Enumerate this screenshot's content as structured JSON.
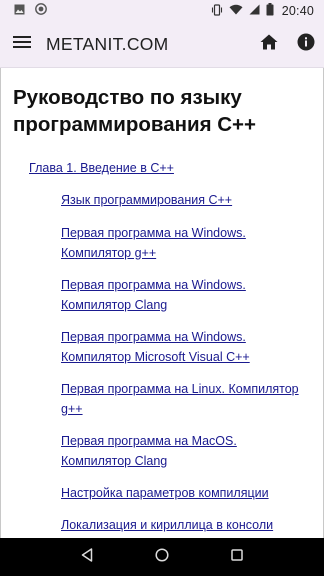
{
  "status_bar": {
    "time": "20:40",
    "icons": [
      "image-icon",
      "record-icon",
      "vibrate-icon",
      "wifi-icon",
      "signal-icon",
      "battery-icon"
    ]
  },
  "app_bar": {
    "title": "METANIT.COM",
    "icons": [
      "menu-icon",
      "home-icon",
      "info-icon"
    ]
  },
  "page": {
    "title_line1": "Руководство по языку",
    "title_line2": "программирования C++",
    "chapter": "Глава 1. Введение в C++",
    "lessons": [
      {
        "line1": "Язык программирования C++",
        "line2": ""
      },
      {
        "line1": "Первая программа на Windows.",
        "line2": "Компилятор g++"
      },
      {
        "line1": "Первая программа на Windows.",
        "line2": "Компилятор Clang"
      },
      {
        "line1": "Первая программа на Windows.",
        "line2": "Компилятор Microsoft Visual C++"
      },
      {
        "line1": "Первая программа на Linux. Компилятор",
        "line2": "g++"
      },
      {
        "line1": "Первая программа на MacOS.",
        "line2": "Компилятор Clang"
      },
      {
        "line1": "Настройка параметров компиляции",
        "line2": ""
      },
      {
        "line1": "Локализация и кириллица в консоли",
        "line2": ""
      }
    ]
  },
  "nav_bar": {
    "icons": [
      "back-icon",
      "home-circle-icon",
      "recents-icon"
    ]
  },
  "colors": {
    "app_bar_bg": "#f3edf6",
    "link": "#1a1a8f",
    "nav_bg": "#000000"
  }
}
